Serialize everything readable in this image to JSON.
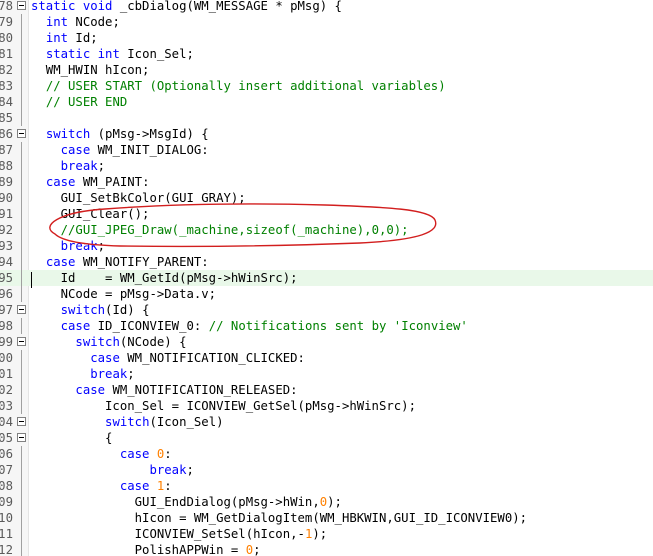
{
  "editor": {
    "colors": {
      "keyword": "#0000ff",
      "comment": "#008000",
      "number": "#ff8000",
      "highlight": "#e9f8e9",
      "annotation": "#d21e1e"
    },
    "lines": [
      {
        "no": "78",
        "fold": "box",
        "segs": [
          [
            "kw",
            "static void "
          ],
          [
            "",
            "_cbDialog(WM_MESSAGE * pMsg) {"
          ]
        ]
      },
      {
        "no": "79",
        "fold": "line",
        "segs": [
          [
            "",
            "  "
          ],
          [
            "kw",
            "int"
          ],
          [
            "",
            " NCode;"
          ]
        ]
      },
      {
        "no": "80",
        "fold": "line",
        "segs": [
          [
            "",
            "  "
          ],
          [
            "kw",
            "int"
          ],
          [
            "",
            " Id;"
          ]
        ]
      },
      {
        "no": "81",
        "fold": "line",
        "segs": [
          [
            "",
            "  "
          ],
          [
            "kw",
            "static int"
          ],
          [
            "",
            " Icon_Sel;"
          ]
        ]
      },
      {
        "no": "82",
        "fold": "line",
        "segs": [
          [
            "",
            "  WM_HWIN hIcon;"
          ]
        ]
      },
      {
        "no": "83",
        "fold": "line",
        "segs": [
          [
            "",
            "  "
          ],
          [
            "cm",
            "// USER START (Optionally insert additional variables)"
          ]
        ]
      },
      {
        "no": "84",
        "fold": "line",
        "segs": [
          [
            "",
            "  "
          ],
          [
            "cm",
            "// USER END"
          ]
        ]
      },
      {
        "no": "85",
        "fold": "line",
        "segs": []
      },
      {
        "no": "86",
        "fold": "box",
        "segs": [
          [
            "",
            "  "
          ],
          [
            "kw",
            "switch"
          ],
          [
            "",
            " (pMsg->MsgId) {"
          ]
        ]
      },
      {
        "no": "87",
        "fold": "line",
        "segs": [
          [
            "",
            "    "
          ],
          [
            "kw",
            "case"
          ],
          [
            "",
            " WM_INIT_DIALOG:"
          ]
        ]
      },
      {
        "no": "88",
        "fold": "line",
        "segs": [
          [
            "",
            "    "
          ],
          [
            "kw",
            "break"
          ],
          [
            "",
            ";"
          ]
        ]
      },
      {
        "no": "89",
        "fold": "line",
        "segs": [
          [
            "",
            "  "
          ],
          [
            "kw",
            "case"
          ],
          [
            "",
            " WM_PAINT:"
          ]
        ]
      },
      {
        "no": "90",
        "fold": "line",
        "segs": [
          [
            "",
            "    GUI_SetBkColor(GUI_GRAY);"
          ]
        ]
      },
      {
        "no": "91",
        "fold": "line",
        "segs": [
          [
            "",
            "    GUI_Clear();"
          ]
        ]
      },
      {
        "no": "92",
        "fold": "line",
        "segs": [
          [
            "",
            "    "
          ],
          [
            "cm",
            "//GUI_JPEG_Draw(_machine,sizeof(_machine),0,0);"
          ]
        ]
      },
      {
        "no": "93",
        "fold": "line",
        "segs": [
          [
            "",
            "    "
          ],
          [
            "kw",
            "break"
          ],
          [
            "",
            ";"
          ]
        ]
      },
      {
        "no": "94",
        "fold": "line",
        "segs": [
          [
            "",
            "  "
          ],
          [
            "kw",
            "case"
          ],
          [
            "",
            " WM_NOTIFY_PARENT:"
          ]
        ]
      },
      {
        "no": "95",
        "fold": "line",
        "hl": true,
        "segs": [
          [
            "",
            "    Id    = WM_GetId(pMsg->hWinSrc);"
          ]
        ]
      },
      {
        "no": "96",
        "fold": "line",
        "segs": [
          [
            "",
            "    NCode = pMsg->Data.v;"
          ]
        ]
      },
      {
        "no": "97",
        "fold": "box",
        "segs": [
          [
            "",
            "    "
          ],
          [
            "kw",
            "switch"
          ],
          [
            "",
            "(Id) {"
          ]
        ]
      },
      {
        "no": "98",
        "fold": "line",
        "segs": [
          [
            "",
            "    "
          ],
          [
            "kw",
            "case"
          ],
          [
            "",
            " ID_ICONVIEW_0: "
          ],
          [
            "cm",
            "// Notifications sent by 'Iconview'"
          ]
        ]
      },
      {
        "no": "99",
        "fold": "box",
        "segs": [
          [
            "",
            "      "
          ],
          [
            "kw",
            "switch"
          ],
          [
            "",
            "(NCode) {"
          ]
        ]
      },
      {
        "no": "100",
        "fold": "line",
        "segs": [
          [
            "",
            "        "
          ],
          [
            "kw",
            "case"
          ],
          [
            "",
            " WM_NOTIFICATION_CLICKED:"
          ]
        ]
      },
      {
        "no": "101",
        "fold": "line",
        "segs": [
          [
            "",
            "        "
          ],
          [
            "kw",
            "break"
          ],
          [
            "",
            ";"
          ]
        ]
      },
      {
        "no": "102",
        "fold": "line",
        "segs": [
          [
            "",
            "      "
          ],
          [
            "kw",
            "case"
          ],
          [
            "",
            " WM_NOTIFICATION_RELEASED:"
          ]
        ]
      },
      {
        "no": "103",
        "fold": "line",
        "segs": [
          [
            "",
            "          Icon_Sel = ICONVIEW_GetSel(pMsg->hWinSrc);"
          ]
        ]
      },
      {
        "no": "104",
        "fold": "box",
        "segs": [
          [
            "",
            "          "
          ],
          [
            "kw",
            "switch"
          ],
          [
            "",
            "(Icon_Sel)"
          ]
        ]
      },
      {
        "no": "105",
        "fold": "box",
        "segs": [
          [
            "",
            "          {"
          ]
        ]
      },
      {
        "no": "106",
        "fold": "line",
        "segs": [
          [
            "",
            "            "
          ],
          [
            "kw",
            "case"
          ],
          [
            "",
            " "
          ],
          [
            "num",
            "0"
          ],
          [
            "",
            ":"
          ]
        ]
      },
      {
        "no": "107",
        "fold": "line",
        "segs": [
          [
            "",
            "                "
          ],
          [
            "kw",
            "break"
          ],
          [
            "",
            ";"
          ]
        ]
      },
      {
        "no": "108",
        "fold": "line",
        "segs": [
          [
            "",
            "            "
          ],
          [
            "kw",
            "case"
          ],
          [
            "",
            " "
          ],
          [
            "num",
            "1"
          ],
          [
            "",
            ":"
          ]
        ]
      },
      {
        "no": "109",
        "fold": "line",
        "segs": [
          [
            "",
            "              GUI_EndDialog(pMsg->hWin,"
          ],
          [
            "num",
            "0"
          ],
          [
            "",
            ");"
          ]
        ]
      },
      {
        "no": "110",
        "fold": "line",
        "segs": [
          [
            "",
            "              hIcon = WM_GetDialogItem(WM_HBKWIN,GUI_ID_ICONVIEW0);"
          ]
        ]
      },
      {
        "no": "111",
        "fold": "line",
        "segs": [
          [
            "",
            "              ICONVIEW_SetSel(hIcon,-"
          ],
          [
            "num",
            "1"
          ],
          [
            "",
            ");"
          ]
        ]
      },
      {
        "no": "112",
        "fold": "line",
        "segs": [
          [
            "",
            "              PolishAPPWin = "
          ],
          [
            "num",
            "0"
          ],
          [
            "",
            ";"
          ]
        ]
      }
    ]
  }
}
